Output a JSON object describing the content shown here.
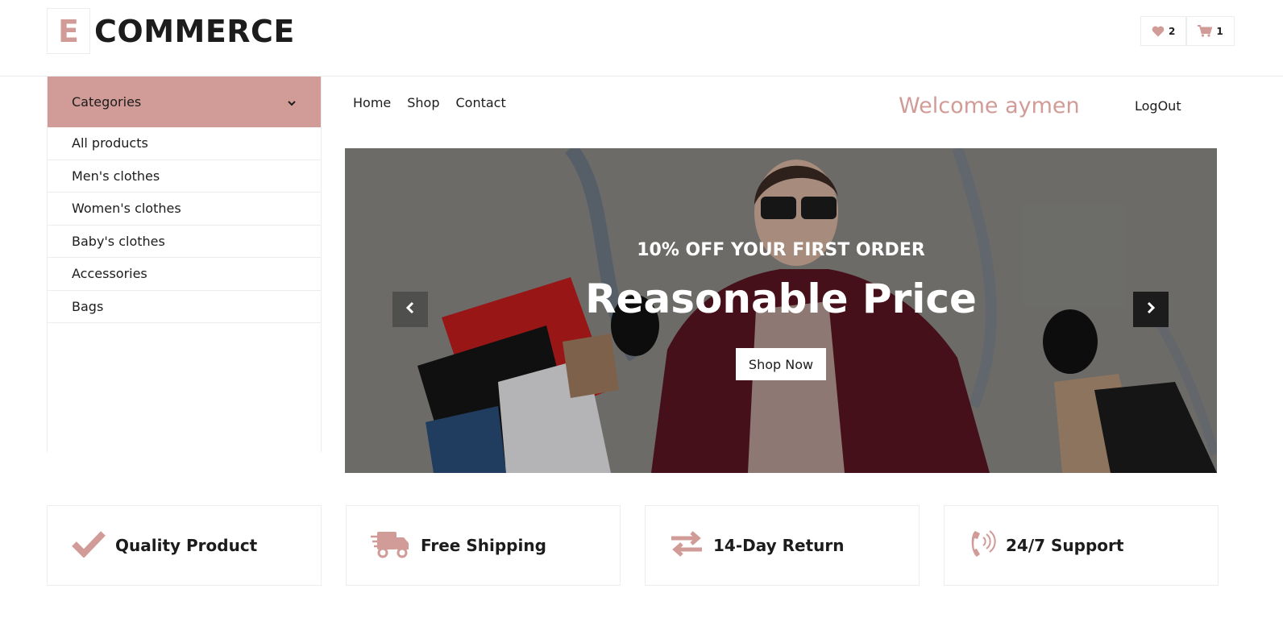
{
  "header": {
    "logo_letter": "E",
    "logo_text": "COMMERCE",
    "wishlist_count": "2",
    "cart_count": "1"
  },
  "sidebar": {
    "title": "Categories",
    "items": [
      {
        "label": "All products"
      },
      {
        "label": "Men's clothes"
      },
      {
        "label": "Women's clothes"
      },
      {
        "label": "Baby's clothes"
      },
      {
        "label": "Accessories"
      },
      {
        "label": "Bags"
      }
    ]
  },
  "nav": {
    "links": [
      {
        "label": "Home"
      },
      {
        "label": "Shop"
      },
      {
        "label": "Contact"
      }
    ],
    "welcome": "Welcome aymen",
    "logout": "LogOut"
  },
  "hero": {
    "kicker": "10% OFF YOUR FIRST ORDER",
    "title": "Reasonable Price",
    "button": "Shop Now"
  },
  "features": [
    {
      "label": "Quality Product",
      "icon": "check-icon"
    },
    {
      "label": "Free Shipping",
      "icon": "shipping-truck-icon"
    },
    {
      "label": "14-Day Return",
      "icon": "exchange-arrows-icon"
    },
    {
      "label": "24/7 Support",
      "icon": "phone-volume-icon"
    }
  ],
  "colors": {
    "accent": "#d19c97",
    "text": "#1c1c1c",
    "border": "#ececf1"
  }
}
